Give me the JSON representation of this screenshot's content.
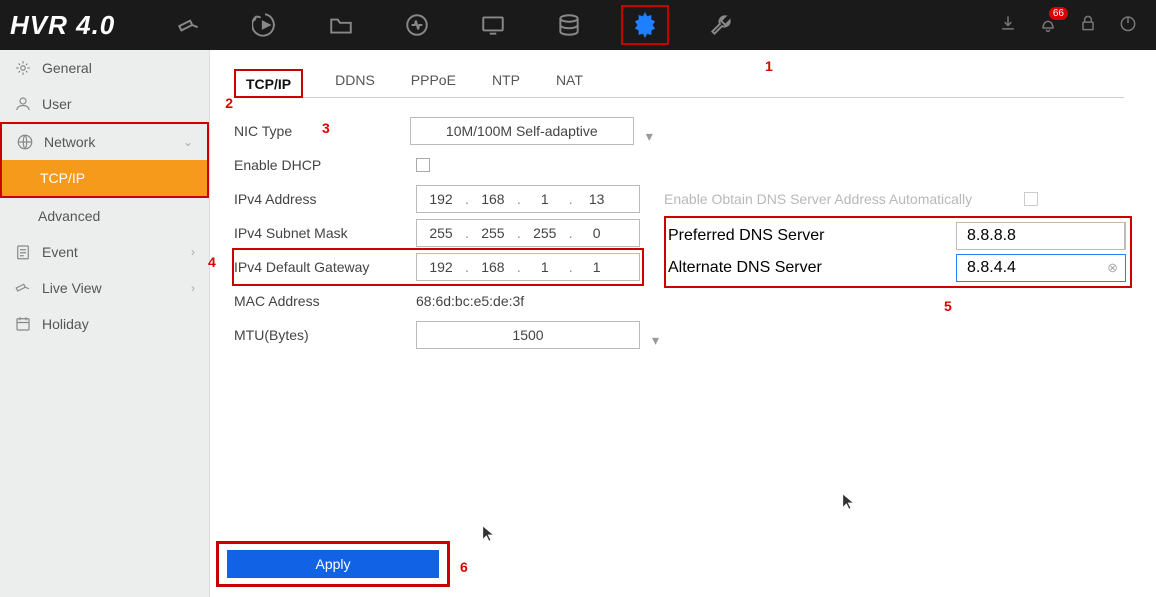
{
  "app_title": "HVR 4.0",
  "topbar": {
    "badge_count": "66"
  },
  "sidebar": {
    "items": [
      {
        "label": "General"
      },
      {
        "label": "User"
      },
      {
        "label": "Network",
        "expanded": true,
        "children": [
          {
            "label": "TCP/IP",
            "active": true
          },
          {
            "label": "Advanced"
          }
        ]
      },
      {
        "label": "Event"
      },
      {
        "label": "Live View"
      },
      {
        "label": "Holiday"
      }
    ]
  },
  "tabs": [
    {
      "label": "TCP/IP",
      "active": true
    },
    {
      "label": "DDNS"
    },
    {
      "label": "PPPoE"
    },
    {
      "label": "NTP"
    },
    {
      "label": "NAT"
    }
  ],
  "form": {
    "nic_type_label": "NIC Type",
    "nic_type_value": "10M/100M Self-adaptive",
    "enable_dhcp_label": "Enable DHCP",
    "ipv4_addr_label": "IPv4 Address",
    "ipv4_addr": [
      "192",
      "168",
      "1",
      "13"
    ],
    "ipv4_mask_label": "IPv4 Subnet Mask",
    "ipv4_mask": [
      "255",
      "255",
      "255",
      "0"
    ],
    "ipv4_gw_label": "IPv4 Default Gateway",
    "ipv4_gw": [
      "192",
      "168",
      "1",
      "1"
    ],
    "mac_label": "MAC Address",
    "mac_value": "68:6d:bc:e5:de:3f",
    "mtu_label": "MTU(Bytes)",
    "mtu_value": "1500",
    "auto_dns_label": "Enable Obtain DNS Server Address Automatically",
    "pref_dns_label": "Preferred DNS Server",
    "pref_dns_value": "8.8.8.8",
    "alt_dns_label": "Alternate DNS Server",
    "alt_dns_value": "8.8.4.4"
  },
  "apply_label": "Apply",
  "callouts": {
    "c1": "1",
    "c2": "2",
    "c3": "3",
    "c4": "4",
    "c5": "5",
    "c6": "6"
  }
}
